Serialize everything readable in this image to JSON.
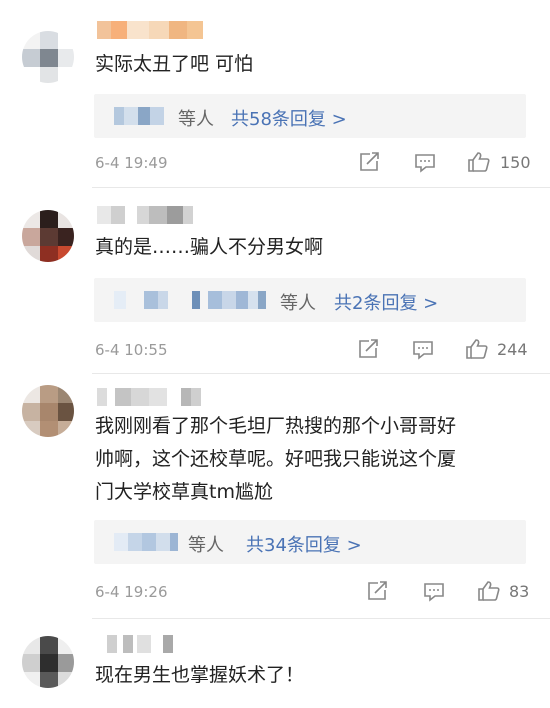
{
  "comments": [
    {
      "text": "实际太丑了吧 可怕",
      "reply_users": "等人",
      "reply_count": "共58条回复 >",
      "time": "6-4 19:49",
      "likes": "150"
    },
    {
      "text": "真的是……骗人不分男女啊",
      "reply_users": "等人",
      "reply_count": "共2条回复 >",
      "time": "6-4 10:55",
      "likes": "244"
    },
    {
      "text_lines": [
        "我刚刚看了那个毛坦厂热搜的那个小哥哥好",
        "帅啊，这个还校草呢。好吧我只能说这个厦",
        "门大学校草真tm尴尬"
      ],
      "reply_users": "等人",
      "reply_count": "共34条回复 >",
      "time": "6-4 19:26",
      "likes": "83"
    },
    {
      "text": "现在男生也掌握妖术了！"
    }
  ],
  "colors": {
    "link": "#4a73b5",
    "meta": "#9a9a9a",
    "reply_bg": "#f4f4f4"
  }
}
